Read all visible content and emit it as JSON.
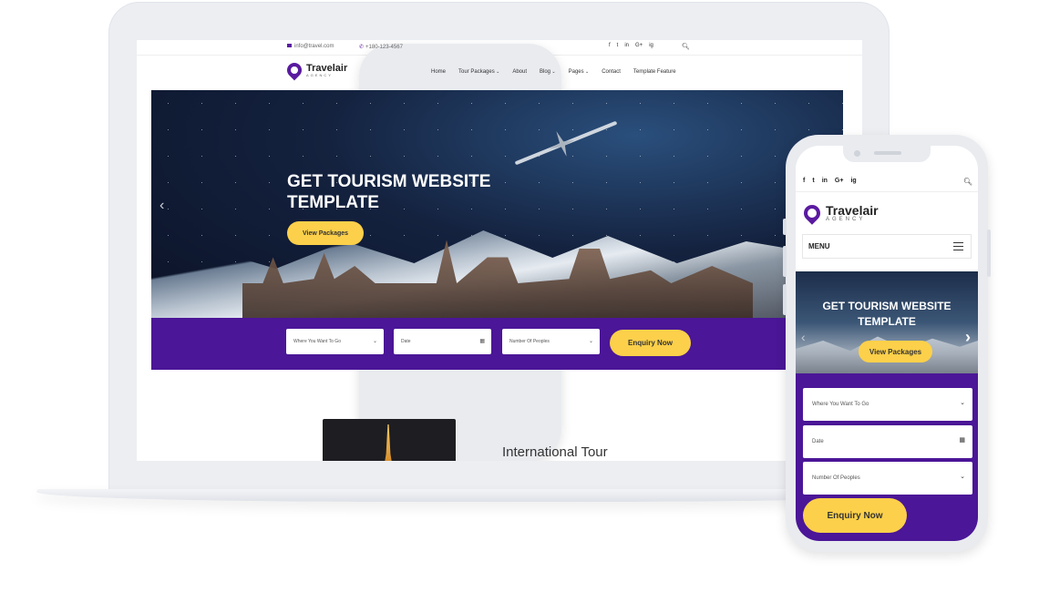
{
  "desktop": {
    "topbar": {
      "email": "info@travel.com",
      "phone": "+180-123-4567",
      "social": [
        "f",
        "t",
        "in",
        "G+",
        "ig"
      ],
      "search_icon": "search-icon"
    },
    "logo": {
      "name": "Travelair",
      "tagline": "AGENCY"
    },
    "nav": [
      "Home",
      "Tour Packages",
      "About",
      "Blog",
      "Pages",
      "Contact",
      "Template Feature"
    ],
    "hero": {
      "title": "GET TOURISM WEBSITE TEMPLATE",
      "button": "View Packages"
    },
    "search": {
      "destination": "Where You Want To Go",
      "date": "Date",
      "people": "Number Of Peoples",
      "submit": "Enquiry Now"
    },
    "section_title": "International Tour"
  },
  "mobile": {
    "social": [
      "f",
      "t",
      "in",
      "G+",
      "ig"
    ],
    "logo": {
      "name": "Travelair",
      "tagline": "AGENCY"
    },
    "menu_label": "MENU",
    "hero": {
      "title": "GET TOURISM WEBSITE TEMPLATE",
      "button": "View Packages"
    },
    "search": {
      "destination": "Where You Want To Go",
      "date": "Date",
      "people": "Number Of Peoples",
      "submit": "Enquiry Now"
    }
  },
  "colors": {
    "brand_purple": "#4b1697",
    "accent_yellow": "#fcd04a",
    "device_frame": "#eceef2"
  }
}
